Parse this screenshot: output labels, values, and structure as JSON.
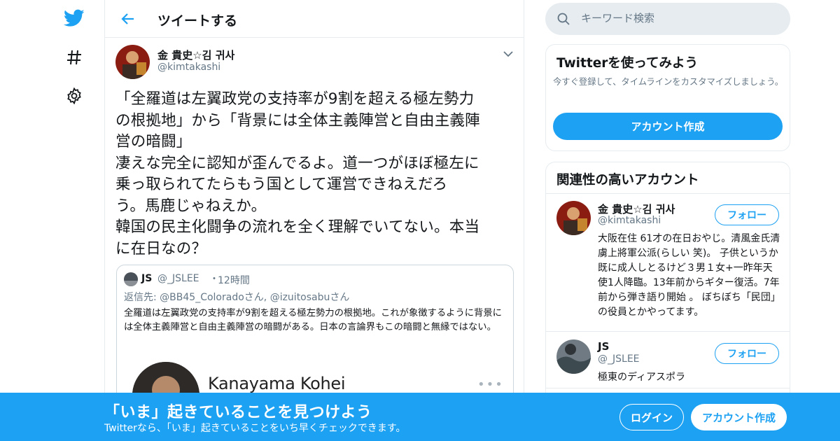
{
  "header": {
    "title": "ツイートする"
  },
  "tweet": {
    "author_name": "金 貴史☆김 귀사",
    "author_handle": "@kimtakashi",
    "text": "「全羅道は左翼政党の支持率が9割を超える極左勢力\nの根拠地」から「背景には全体主義陣営と自由主義陣\n営の暗闘」\n凄えな完全に認知が歪んでるよ。道一つがほぼ極左に\n乗っ取られてたらもう国として運営できねえだろ\nう。馬鹿じゃねえか。\n韓国の民主化闘争の流れを全く理解でいてない。本当\nに在日なの？"
  },
  "quoted": {
    "name": "JS",
    "handle": "@_JSLEE",
    "dot": "・",
    "time": "12時間",
    "reply_prefix": "返信先: ",
    "reply_user1": "@BB45_Coloradoさん",
    "reply_sep": ", ",
    "reply_user2": "@izuitosabuさん",
    "text": "全羅道は左翼政党の支持率が9割を超える極左勢力の根拠地。これが象徴するように背景には全体主義陣営と自由主義陣営の暗闘がある。日本の言論界もこの暗闘と無縁ではない。",
    "media_name": "Kanayama Kohei",
    "media_more": "•••"
  },
  "search": {
    "placeholder": "キーワード検索"
  },
  "signup_card": {
    "title": "Twitterを使ってみよう",
    "description": "今すぐ登録して、タイムラインをカスタマイズしましょう。",
    "button": "アカウント作成"
  },
  "related": {
    "title": "関連性の高いアカウント",
    "accounts": [
      {
        "name": "金 貴史☆김 귀사",
        "handle": "@kimtakashi",
        "bio": "大阪在住 61才の在日おやじ。清風金氏清虜上將軍公派(らしい 笑)。 子供というか既に成人しとるけど３男１女+一昨年天使1人降臨。13年前からギター復活。7年前から弾き語り開始 。 ぼちぼち「民団」の役員とかやってます。",
        "follow": "フォロー"
      },
      {
        "name": "JS",
        "handle": "@_JSLEE",
        "bio": "極東のディアスポラ",
        "follow": "フォロー"
      }
    ]
  },
  "banner": {
    "title": "「いま」起きていることを見つけよう",
    "subtitle": "Twitterなら、「いま」起きていることをいち早くチェックできます。",
    "login": "ログイン",
    "signup": "アカウント作成"
  },
  "colors": {
    "brand": "#1da1f2",
    "text": "#14171a",
    "muted": "#657786",
    "border": "#e6ecf0"
  },
  "icons": {
    "logo": "twitter-bird-icon",
    "explore": "hashtag-icon",
    "settings": "gear-icon",
    "back": "arrow-left-icon",
    "caret": "chevron-down-icon",
    "search": "search-icon"
  }
}
